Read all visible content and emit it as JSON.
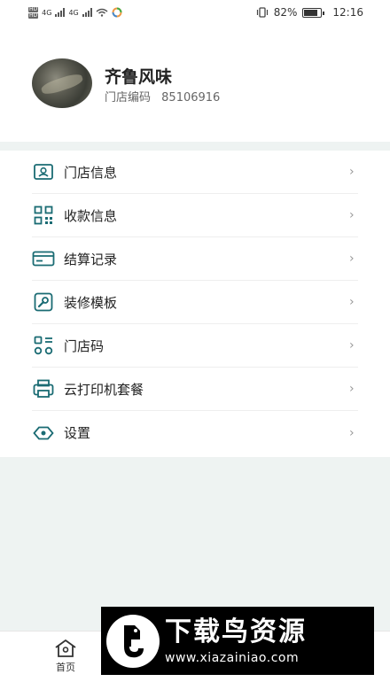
{
  "status_bar": {
    "sim1": "HD",
    "sim2": "HD",
    "network1": "4G",
    "network2": "4G",
    "battery_percent": "82%",
    "time": "12:16"
  },
  "profile": {
    "store_name": "齐鲁风味",
    "code_label": "门店编码",
    "code_value": "85106916"
  },
  "menu": {
    "items": [
      {
        "label": "门店信息",
        "icon": "store-user-icon"
      },
      {
        "label": "收款信息",
        "icon": "qr-code-icon"
      },
      {
        "label": "结算记录",
        "icon": "card-icon"
      },
      {
        "label": "装修模板",
        "icon": "wrench-icon"
      },
      {
        "label": "门店码",
        "icon": "store-code-icon"
      },
      {
        "label": "云打印机套餐",
        "icon": "printer-icon"
      },
      {
        "label": "设置",
        "icon": "settings-eye-icon"
      }
    ]
  },
  "tabbar": {
    "home_label": "首页"
  },
  "watermark": {
    "title": "下载鸟资源",
    "url": "www.xiazainiao.com"
  },
  "colors": {
    "accent": "#1a6b73",
    "background": "#eef3f2"
  }
}
